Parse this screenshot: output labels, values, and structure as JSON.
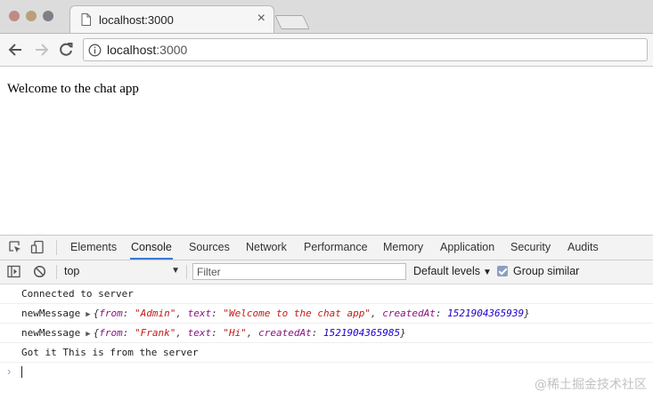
{
  "browser": {
    "tab_title": "localhost:3000",
    "tab_close": "×",
    "url_host": "localhost",
    "url_port": ":3000"
  },
  "page": {
    "text": "Welcome to the chat app"
  },
  "devtools": {
    "tabs": [
      {
        "label": "Elements",
        "active": false
      },
      {
        "label": "Console",
        "active": true
      },
      {
        "label": "Sources",
        "active": false
      },
      {
        "label": "Network",
        "active": false
      },
      {
        "label": "Performance",
        "active": false
      },
      {
        "label": "Memory",
        "active": false
      },
      {
        "label": "Application",
        "active": false
      },
      {
        "label": "Security",
        "active": false
      },
      {
        "label": "Audits",
        "active": false
      }
    ],
    "accent_color": "#3879d9",
    "console_bar": {
      "context": "top",
      "filter_placeholder": "Filter",
      "levels": "Default levels",
      "group_similar": "Group similar",
      "group_similar_checked": true
    },
    "console_lines": [
      {
        "text": "Connected to server"
      },
      {
        "label": "newMessage",
        "obj": {
          "open": "{",
          "k1": "from",
          "v1": "\"Admin\"",
          "k2": "text",
          "v2": "\"Welcome to the chat app\"",
          "k3": "createdAt",
          "v3": "1521904365939",
          "close": "}"
        }
      },
      {
        "label": "newMessage",
        "obj": {
          "open": "{",
          "k1": "from",
          "v1": "\"Frank\"",
          "k2": "text",
          "v2": "\"Hi\"",
          "k3": "createdAt",
          "v3": "1521904365985",
          "close": "}"
        }
      },
      {
        "text": "Got it This is from the server"
      }
    ]
  },
  "watermark": "@稀土掘金技术社区"
}
